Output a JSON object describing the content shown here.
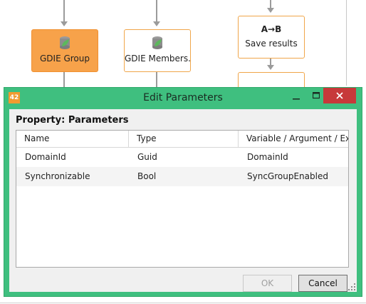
{
  "workflow": {
    "nodes": [
      {
        "label": "GDIE Group",
        "icon": "database-leaf-icon",
        "selected": true
      },
      {
        "label": "GDIE Members...",
        "icon": "database-leaf-icon",
        "selected": false
      },
      {
        "label": "Save results",
        "icon": "a-to-b-icon",
        "icon_text": "A→B",
        "selected": false
      }
    ]
  },
  "dialog": {
    "title": "Edit Parameters",
    "app_icon_text": "42",
    "property_label": "Property:  Parameters",
    "columns": [
      "Name",
      "Type",
      "Variable / Argument / Expre"
    ],
    "rows": [
      {
        "name": "DomainId",
        "type": "Guid",
        "value": "DomainId"
      },
      {
        "name": "Synchronizable",
        "type": "Bool",
        "value": "SyncGroupEnabled"
      }
    ],
    "ok_label": "OK",
    "cancel_label": "Cancel",
    "ok_enabled": false
  },
  "colors": {
    "dialog_frame": "#3fbf7f",
    "node_border": "#f0a64a",
    "node_selected": "#f7a24a",
    "close_button": "#c7393a"
  }
}
